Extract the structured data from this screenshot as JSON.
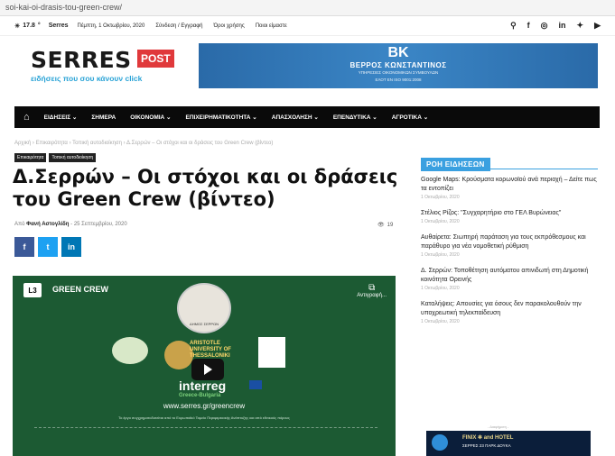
{
  "browser": {
    "url": "soi-kai-oi-drasis-tou-green-crew/"
  },
  "topbar": {
    "weather_icon": "sun-icon",
    "temperature": "17.8",
    "temp_unit": "°",
    "city": "Serres",
    "date": "Πέμπτη, 1 Οκτωβρίου, 2020",
    "login": "Σύνδεση / Εγγραφή",
    "terms": "Όροι χρήσης",
    "about": "Ποιοι είμαστε",
    "icons": [
      "search-icon",
      "facebook-icon",
      "instagram-icon",
      "linkedin-icon",
      "twitter-icon",
      "youtube-icon"
    ]
  },
  "logo": {
    "name": "SERRES",
    "badge": "POST",
    "tagline": "ειδήσεις που σου κάνουν click"
  },
  "banner": {
    "mark": "BK",
    "name": "ΒΕΡΡΟΣ ΚΩΝΣΤΑΝΤΙΝΟΣ",
    "subtitle": "ΥΠΗΡΕΣΙΕΣ ΟΙΚΟΝΟΜΙΚΩΝ ΣΥΜΒΟΥΛΩΝ",
    "cert": "ΕΛΟΤ EN ISO 9001:2008"
  },
  "nav": {
    "items": [
      "ΕΙΔΗΣΕΙΣ ⌄",
      "ΣΗΜΕΡΑ",
      "ΟΙΚΟΝΟΜΙΑ ⌄",
      "ΕΠΙΧΕΙΡΗΜΑΤΙΚΟΤΗΤΑ ⌄",
      "ΑΠΑΣΧΟΛΗΣΗ ⌄",
      "ΕΠΕΝΔΥΤΙΚΑ ⌄",
      "ΑΓΡΟΤΙΚΑ ⌄"
    ]
  },
  "article": {
    "breadcrumb": "Αρχική › Επικαιρότητα › Τοπική αυτοδιοίκηση › Δ.Σερρών – Οι στόχοι και οι δράσεις του Green Crew (βίντεο)",
    "categories": [
      "Επικαιρότητα",
      "Τοπική αυτοδιοίκηση"
    ],
    "title": "Δ.Σερρών – Οι στόχοι και οι δράσεις του Green Crew (βίντεο)",
    "by": "Από",
    "author": "Φανή Αστογλίδη",
    "date": "- 25 Σεπτεμβρίου, 2020",
    "views": "19",
    "share": [
      "f",
      "t",
      "in"
    ]
  },
  "video": {
    "channel_badge": "L3",
    "title": "GREEN CREW",
    "copy_label": "Αντιγραφή...",
    "coin_text": "ΔΗΜΟΣ ΣΕΡΡΩΝ",
    "auth_text": "ARISTOTLE UNIVERSITY OF THESSALONIKI",
    "program": "interreg",
    "region": "Greece-Bulgaria",
    "url": "www.serres.gr/greencrew",
    "funding": "Το έργο συγχρηματοδοτείται από το Ευρωπαϊκό Ταμείο Περιφερειακής Ανάπτυξης και από εθνικούς πόρους"
  },
  "sidebar": {
    "heading": "ΡΟΗ ΕΙΔΗΣΕΩΝ",
    "news": [
      {
        "title": "Google Maps: Κρούσματα κορωνοϊού ανά περιοχή – Δείτε πως τα εντοπίζει",
        "date": "1 Οκτωβρίου, 2020"
      },
      {
        "title": "Στέλιος Ρίζος: \"Συγχαρητήριο στο ΓΕΛ Βυρώνειας\"",
        "date": "1 Οκτωβρίου, 2020"
      },
      {
        "title": "Αυθαίρετα: Σιωπηρή παράταση για τους εκπρόθεσμους και παράθυρο για νέα νομοθετική ρύθμιση",
        "date": "1 Οκτωβρίου, 2020"
      },
      {
        "title": "Δ. Σερρών: Τοποθέτηση αυτόματου απινιδωτή στη Δημοτική κοινότητα Ορεινής",
        "date": "1 Οκτωβρίου, 2020"
      },
      {
        "title": "Καταλήψεις: Απουσίες για όσους δεν παρακολουθούν την υποχρεωτική τηλεκπαίδευση",
        "date": "1 Οκτωβρίου, 2020"
      }
    ],
    "ad_label": "- Διαφήμιση -",
    "ad_title": "FINIX ✻ and HOTEL",
    "ad_sub": "ΣΕΡΡΕΣ 23 ΠΑΡΚ ΔΟΥΚΑ"
  },
  "colors": {
    "accent": "#3aa0e0",
    "post_red": "#e0393b",
    "nav_bg": "#0a0a0a",
    "facebook": "#3b5998",
    "twitter": "#1da1f2",
    "linkedin": "#0077b5"
  }
}
